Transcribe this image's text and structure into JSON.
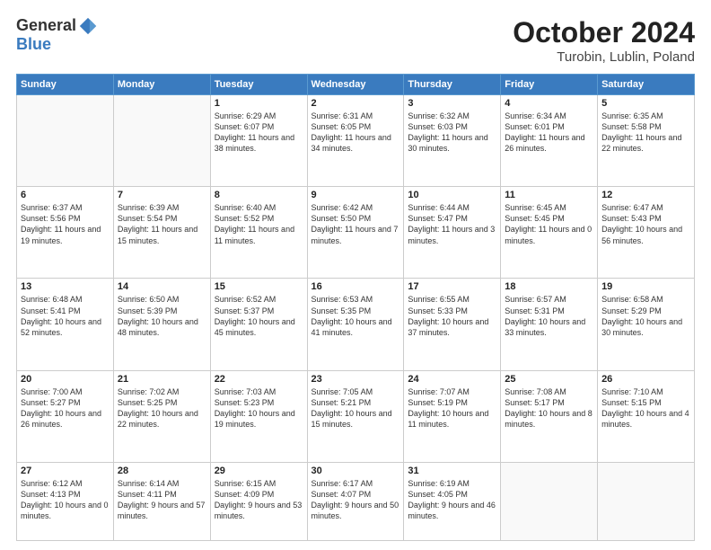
{
  "logo": {
    "general": "General",
    "blue": "Blue"
  },
  "header": {
    "month": "October 2024",
    "location": "Turobin, Lublin, Poland"
  },
  "weekdays": [
    "Sunday",
    "Monday",
    "Tuesday",
    "Wednesday",
    "Thursday",
    "Friday",
    "Saturday"
  ],
  "weeks": [
    [
      {
        "day": "",
        "info": ""
      },
      {
        "day": "",
        "info": ""
      },
      {
        "day": "1",
        "info": "Sunrise: 6:29 AM\nSunset: 6:07 PM\nDaylight: 11 hours and 38 minutes."
      },
      {
        "day": "2",
        "info": "Sunrise: 6:31 AM\nSunset: 6:05 PM\nDaylight: 11 hours and 34 minutes."
      },
      {
        "day": "3",
        "info": "Sunrise: 6:32 AM\nSunset: 6:03 PM\nDaylight: 11 hours and 30 minutes."
      },
      {
        "day": "4",
        "info": "Sunrise: 6:34 AM\nSunset: 6:01 PM\nDaylight: 11 hours and 26 minutes."
      },
      {
        "day": "5",
        "info": "Sunrise: 6:35 AM\nSunset: 5:58 PM\nDaylight: 11 hours and 22 minutes."
      }
    ],
    [
      {
        "day": "6",
        "info": "Sunrise: 6:37 AM\nSunset: 5:56 PM\nDaylight: 11 hours and 19 minutes."
      },
      {
        "day": "7",
        "info": "Sunrise: 6:39 AM\nSunset: 5:54 PM\nDaylight: 11 hours and 15 minutes."
      },
      {
        "day": "8",
        "info": "Sunrise: 6:40 AM\nSunset: 5:52 PM\nDaylight: 11 hours and 11 minutes."
      },
      {
        "day": "9",
        "info": "Sunrise: 6:42 AM\nSunset: 5:50 PM\nDaylight: 11 hours and 7 minutes."
      },
      {
        "day": "10",
        "info": "Sunrise: 6:44 AM\nSunset: 5:47 PM\nDaylight: 11 hours and 3 minutes."
      },
      {
        "day": "11",
        "info": "Sunrise: 6:45 AM\nSunset: 5:45 PM\nDaylight: 11 hours and 0 minutes."
      },
      {
        "day": "12",
        "info": "Sunrise: 6:47 AM\nSunset: 5:43 PM\nDaylight: 10 hours and 56 minutes."
      }
    ],
    [
      {
        "day": "13",
        "info": "Sunrise: 6:48 AM\nSunset: 5:41 PM\nDaylight: 10 hours and 52 minutes."
      },
      {
        "day": "14",
        "info": "Sunrise: 6:50 AM\nSunset: 5:39 PM\nDaylight: 10 hours and 48 minutes."
      },
      {
        "day": "15",
        "info": "Sunrise: 6:52 AM\nSunset: 5:37 PM\nDaylight: 10 hours and 45 minutes."
      },
      {
        "day": "16",
        "info": "Sunrise: 6:53 AM\nSunset: 5:35 PM\nDaylight: 10 hours and 41 minutes."
      },
      {
        "day": "17",
        "info": "Sunrise: 6:55 AM\nSunset: 5:33 PM\nDaylight: 10 hours and 37 minutes."
      },
      {
        "day": "18",
        "info": "Sunrise: 6:57 AM\nSunset: 5:31 PM\nDaylight: 10 hours and 33 minutes."
      },
      {
        "day": "19",
        "info": "Sunrise: 6:58 AM\nSunset: 5:29 PM\nDaylight: 10 hours and 30 minutes."
      }
    ],
    [
      {
        "day": "20",
        "info": "Sunrise: 7:00 AM\nSunset: 5:27 PM\nDaylight: 10 hours and 26 minutes."
      },
      {
        "day": "21",
        "info": "Sunrise: 7:02 AM\nSunset: 5:25 PM\nDaylight: 10 hours and 22 minutes."
      },
      {
        "day": "22",
        "info": "Sunrise: 7:03 AM\nSunset: 5:23 PM\nDaylight: 10 hours and 19 minutes."
      },
      {
        "day": "23",
        "info": "Sunrise: 7:05 AM\nSunset: 5:21 PM\nDaylight: 10 hours and 15 minutes."
      },
      {
        "day": "24",
        "info": "Sunrise: 7:07 AM\nSunset: 5:19 PM\nDaylight: 10 hours and 11 minutes."
      },
      {
        "day": "25",
        "info": "Sunrise: 7:08 AM\nSunset: 5:17 PM\nDaylight: 10 hours and 8 minutes."
      },
      {
        "day": "26",
        "info": "Sunrise: 7:10 AM\nSunset: 5:15 PM\nDaylight: 10 hours and 4 minutes."
      }
    ],
    [
      {
        "day": "27",
        "info": "Sunrise: 6:12 AM\nSunset: 4:13 PM\nDaylight: 10 hours and 0 minutes."
      },
      {
        "day": "28",
        "info": "Sunrise: 6:14 AM\nSunset: 4:11 PM\nDaylight: 9 hours and 57 minutes."
      },
      {
        "day": "29",
        "info": "Sunrise: 6:15 AM\nSunset: 4:09 PM\nDaylight: 9 hours and 53 minutes."
      },
      {
        "day": "30",
        "info": "Sunrise: 6:17 AM\nSunset: 4:07 PM\nDaylight: 9 hours and 50 minutes."
      },
      {
        "day": "31",
        "info": "Sunrise: 6:19 AM\nSunset: 4:05 PM\nDaylight: 9 hours and 46 minutes."
      },
      {
        "day": "",
        "info": ""
      },
      {
        "day": "",
        "info": ""
      }
    ]
  ]
}
